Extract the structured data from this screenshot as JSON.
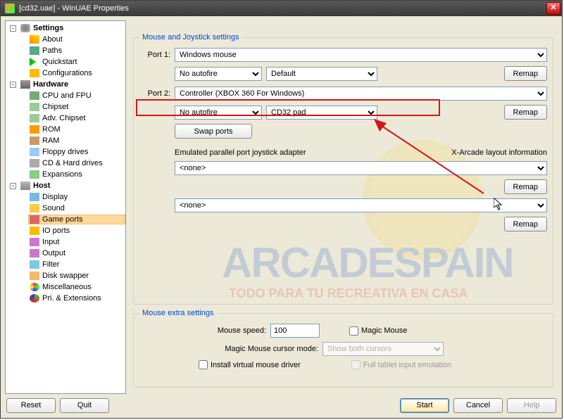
{
  "title": "[cd32.uae] - WinUAE Properties",
  "sidebar": {
    "settings": "Settings",
    "items1": [
      "About",
      "Paths",
      "Quickstart",
      "Configurations"
    ],
    "hardware": "Hardware",
    "items2": [
      "CPU and FPU",
      "Chipset",
      "Adv. Chipset",
      "ROM",
      "RAM",
      "Floppy drives",
      "CD & Hard drives",
      "Expansions"
    ],
    "host": "Host",
    "items3": [
      "Display",
      "Sound",
      "Game ports",
      "IO ports",
      "Input",
      "Output",
      "Filter",
      "Disk swapper",
      "Miscellaneous",
      "Pri. & Extensions"
    ]
  },
  "group1": {
    "legend": "Mouse and Joystick settings",
    "port1_label": "Port 1:",
    "port1_device": "Windows mouse",
    "port1_autofire": "No autofire",
    "port1_mode": "Default",
    "port2_label": "Port 2:",
    "port2_device": "Controller (XBOX 360 For Windows)",
    "port2_autofire": "No autofire",
    "port2_mode": "CD32 pad",
    "remap": "Remap",
    "swap": "Swap ports",
    "adapter_label": "Emulated parallel port joystick adapter",
    "xarcade_label": "X-Arcade layout information",
    "none": "<none>"
  },
  "group2": {
    "legend": "Mouse extra settings",
    "speed_label": "Mouse speed:",
    "speed_value": "100",
    "cursor_label": "Magic Mouse cursor mode:",
    "cursor_value": "Show both cursors",
    "magic": "Magic Mouse",
    "install": "Install virtual mouse driver",
    "tablet": "Full tablet input emulation"
  },
  "footer": {
    "reset": "Reset",
    "quit": "Quit",
    "start": "Start",
    "cancel": "Cancel",
    "help": "Help"
  },
  "watermark": {
    "t1": "ARCADESPAIN",
    "t2": "TODO PARA TU RECREATIVA EN CASA"
  }
}
